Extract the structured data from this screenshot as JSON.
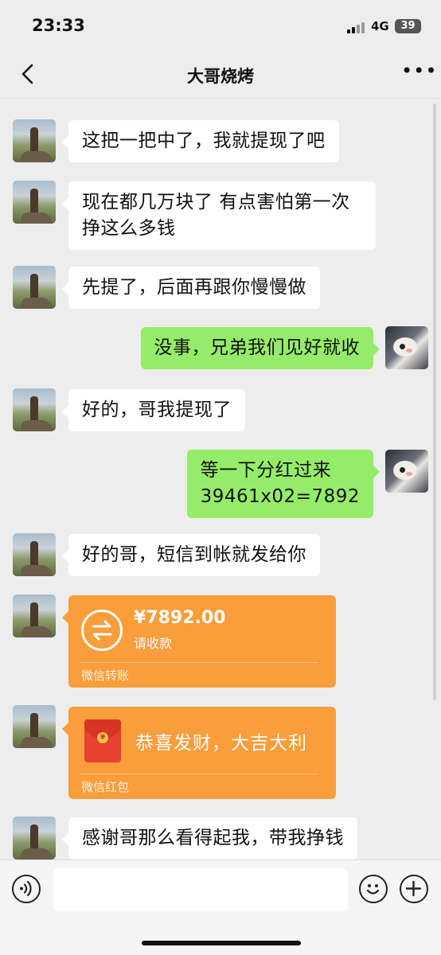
{
  "status_bar": {
    "time": "23:33",
    "network": "4G",
    "battery": "39"
  },
  "header": {
    "title": "大哥烧烤",
    "back_icon": "chevron-left-icon",
    "more_label": "•••"
  },
  "messages": [
    {
      "side": "left",
      "text": "这把一把中了，我就提现了吧"
    },
    {
      "side": "left",
      "text": "现在都几万块了 有点害怕第一次挣这么多钱"
    },
    {
      "side": "left",
      "text": "先提了，后面再跟你慢慢做"
    },
    {
      "side": "right",
      "text": "没事，兄弟我们见好就收"
    },
    {
      "side": "left",
      "text": "好的，哥我提现了"
    },
    {
      "side": "right",
      "text": "等一下分红过来\n39461x02=7892"
    },
    {
      "side": "left",
      "text": "好的哥，短信到帐就发给你"
    },
    {
      "side": "left",
      "type": "transfer",
      "amount": "¥7892.00",
      "status": "请收款",
      "footer": "微信转账"
    },
    {
      "side": "left",
      "type": "red_packet",
      "greeting": "恭喜发财，大吉大利",
      "footer": "微信红包",
      "seal": "¥"
    },
    {
      "side": "left",
      "text": "感谢哥那么看得起我，带我挣钱"
    }
  ],
  "input_bar": {
    "placeholder": ""
  },
  "colors": {
    "sent_bubble": "#95ec69",
    "received_bubble": "#ffffff",
    "transfer_card": "#fa9d3b",
    "background": "#ededed"
  }
}
